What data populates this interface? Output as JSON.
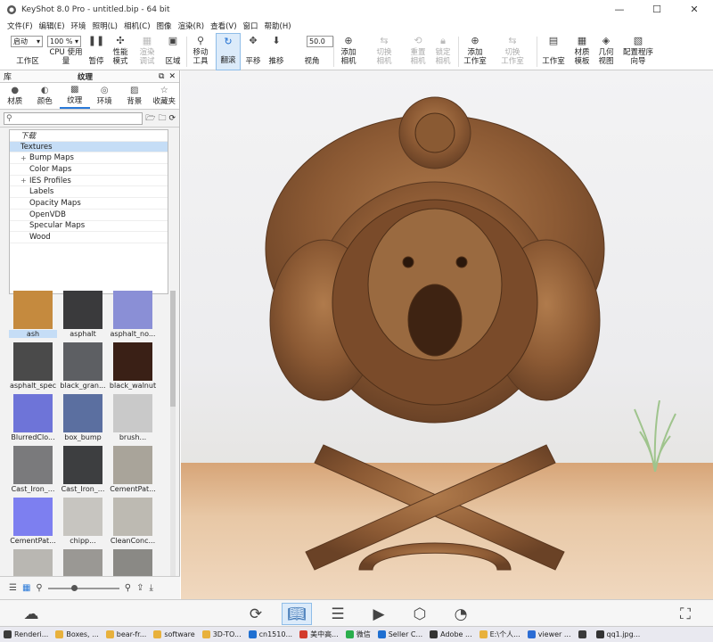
{
  "window": {
    "title": "KeyShot 8.0 Pro  - untitled.bip  - 64 bit",
    "min": "—",
    "max": "☐",
    "close": "✕"
  },
  "menu": [
    "文件(F)",
    "编辑(E)",
    "环境",
    "照明(L)",
    "相机(C)",
    "图像",
    "渲染(R)",
    "查看(V)",
    "窗口",
    "帮助(H)"
  ],
  "toolbar": {
    "workspace_combo": "启动",
    "zoom_combo": "100 %",
    "fov_value": "50.0",
    "workspace": "工作区",
    "cpu": "CPU 使用量",
    "pause": "暂停",
    "perf": "性能\n模式",
    "denoise": "渲染\n调试",
    "region": "区域",
    "move_tool": "移动\n工具",
    "tumble": "翻滚",
    "pan": "平移",
    "dolly": "推移",
    "fov": "视角",
    "add_camera": "添加\n相机",
    "switch_camera": "切换\n相机",
    "reset_camera": "重置\n相机",
    "lock_camera": "锁定\n相机",
    "add_studio": "添加\n工作室",
    "switch_studio": "切换\n工作室",
    "studio": "工作室",
    "material_template": "材质\n模板",
    "geometry_view": "几何\n视图",
    "config_wizard": "配置程序\n向导"
  },
  "panel": {
    "library_label": "库",
    "title": "纹理",
    "tabs": [
      {
        "icon": "material-icon",
        "label": "材质"
      },
      {
        "icon": "color-icon",
        "label": "颜色"
      },
      {
        "icon": "texture-icon",
        "label": "纹理"
      },
      {
        "icon": "environment-icon",
        "label": "环境"
      },
      {
        "icon": "backplate-icon",
        "label": "背景"
      },
      {
        "icon": "favorites-icon",
        "label": "收藏夹"
      }
    ],
    "search_placeholder": "",
    "tree": [
      {
        "label": "下载",
        "level": 0,
        "expand": ""
      },
      {
        "label": "Textures",
        "level": 0,
        "expand": "",
        "selected": true
      },
      {
        "label": "Bump Maps",
        "level": 1,
        "expand": "+"
      },
      {
        "label": "Color Maps",
        "level": 1,
        "expand": ""
      },
      {
        "label": "IES Profiles",
        "level": 1,
        "expand": "+"
      },
      {
        "label": "Labels",
        "level": 1,
        "expand": ""
      },
      {
        "label": "Opacity Maps",
        "level": 1,
        "expand": ""
      },
      {
        "label": "OpenVDB",
        "level": 1,
        "expand": ""
      },
      {
        "label": "Specular Maps",
        "level": 1,
        "expand": ""
      },
      {
        "label": "Wood",
        "level": 1,
        "expand": ""
      }
    ],
    "thumbnails": [
      {
        "label": "ash",
        "color": "#c58a3e"
      },
      {
        "label": "asphalt",
        "color": "#3a3a3c"
      },
      {
        "label": "asphalt_no...",
        "color": "#8a8fd6"
      },
      {
        "label": "asphalt_spec",
        "color": "#4a4a4a"
      },
      {
        "label": "black_gran...",
        "color": "#5d5f63"
      },
      {
        "label": "black_walnut",
        "color": "#3a2016"
      },
      {
        "label": "BlurredClo...",
        "color": "#6e74d8"
      },
      {
        "label": "box_bump",
        "color": "#5b6fa0"
      },
      {
        "label": "brush...",
        "color": "#c9c9c9"
      },
      {
        "label": "Cast_Iron_...",
        "color": "#7a7a7c"
      },
      {
        "label": "Cast_Iron_...",
        "color": "#3d3e40"
      },
      {
        "label": "CementPat...",
        "color": "#a9a49a"
      },
      {
        "label": "CementPat...",
        "color": "#7d7ff0"
      },
      {
        "label": "chipp...",
        "color": "#c7c5c0"
      },
      {
        "label": "CleanConc...",
        "color": "#bdbab2"
      },
      {
        "label": "",
        "color": "#b9b7b2"
      },
      {
        "label": "",
        "color": "#9a9894"
      },
      {
        "label": "",
        "color": "#8a8985"
      }
    ]
  },
  "bottombar_icons": [
    "cloud-icon",
    "import-icon",
    "library-icon",
    "project-icon",
    "animation-icon",
    "keyshotxr-icon",
    "render-icon",
    "screenshot-icon"
  ],
  "taskbar": [
    {
      "label": "Renderi...",
      "color": "#3a3a3a"
    },
    {
      "label": "Boxes, ...",
      "color": "#e8b13c"
    },
    {
      "label": "bear-fr...",
      "color": "#e8b13c"
    },
    {
      "label": "software",
      "color": "#e8b13c"
    },
    {
      "label": "3D-TO...",
      "color": "#e8b13c"
    },
    {
      "label": "cn1510...",
      "color": "#1f6fd1"
    },
    {
      "label": "美中高...",
      "color": "#d33b2c"
    },
    {
      "label": "微信",
      "color": "#2aae4c"
    },
    {
      "label": "Seller C...",
      "color": "#1f6fd1"
    },
    {
      "label": "Adobe ...",
      "color": "#333"
    },
    {
      "label": "E:\\个人...",
      "color": "#e8b13c"
    },
    {
      "label": "viewer ...",
      "color": "#2b6cd4"
    },
    {
      "label": "",
      "color": "#3a3a3a"
    },
    {
      "label": "qq1.jpg...",
      "color": "#333"
    }
  ]
}
